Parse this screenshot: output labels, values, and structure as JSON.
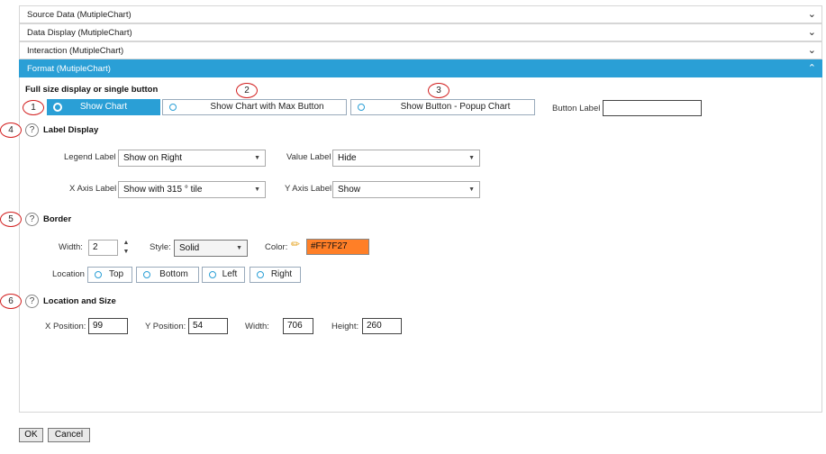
{
  "accordion": [
    {
      "label": "Source Data (MutipleChart)",
      "chevron": "⌄"
    },
    {
      "label": "Data Display (MutipleChart)",
      "chevron": "⌄"
    },
    {
      "label": "Interaction (MutipleChart)",
      "chevron": "⌄"
    },
    {
      "label": "Format (MutipleChart)",
      "chevron": "⌃"
    }
  ],
  "callouts": [
    "1",
    "2",
    "3",
    "4",
    "5",
    "6"
  ],
  "display_mode": {
    "title": "Full size display or single button",
    "options": [
      "Show Chart",
      "Show Chart with Max Button",
      "Show Button - Popup Chart"
    ],
    "selected": "Show Chart",
    "button_label_caption": "Button Label",
    "button_label_value": ""
  },
  "label_display": {
    "title": "Label Display",
    "legend_label": "Legend Label",
    "legend_value": "Show on Right",
    "value_label": "Value Label",
    "value_value": "Hide",
    "x_axis_label": "X Axis Label",
    "x_axis_value": "Show with 315 ° tile",
    "y_axis_label": "Y Axis Label",
    "y_axis_value": "Show"
  },
  "border": {
    "title": "Border",
    "width_label": "Width:",
    "width_value": "2",
    "style_label": "Style:",
    "style_value": "Solid",
    "color_label": "Color:",
    "color_value": "#FF7F27",
    "location_label": "Location",
    "locations": [
      "Top",
      "Bottom",
      "Left",
      "Right"
    ]
  },
  "location_size": {
    "title": "Location and Size",
    "x_label": "X Position:",
    "x_value": "99",
    "y_label": "Y Position:",
    "y_value": "54",
    "w_label": "Width:",
    "w_value": "706",
    "h_label": "Height:",
    "h_value": "260"
  },
  "footer": {
    "ok": "OK",
    "cancel": "Cancel"
  },
  "icons": {
    "help": "?",
    "dropdown": "▼",
    "pencil": "✏",
    "step_up": "▲",
    "step_down": "▼"
  },
  "colors": {
    "accent": "#2a9fd6",
    "callout_ring": "#d21f1f",
    "border_color": "#FF7F27"
  }
}
